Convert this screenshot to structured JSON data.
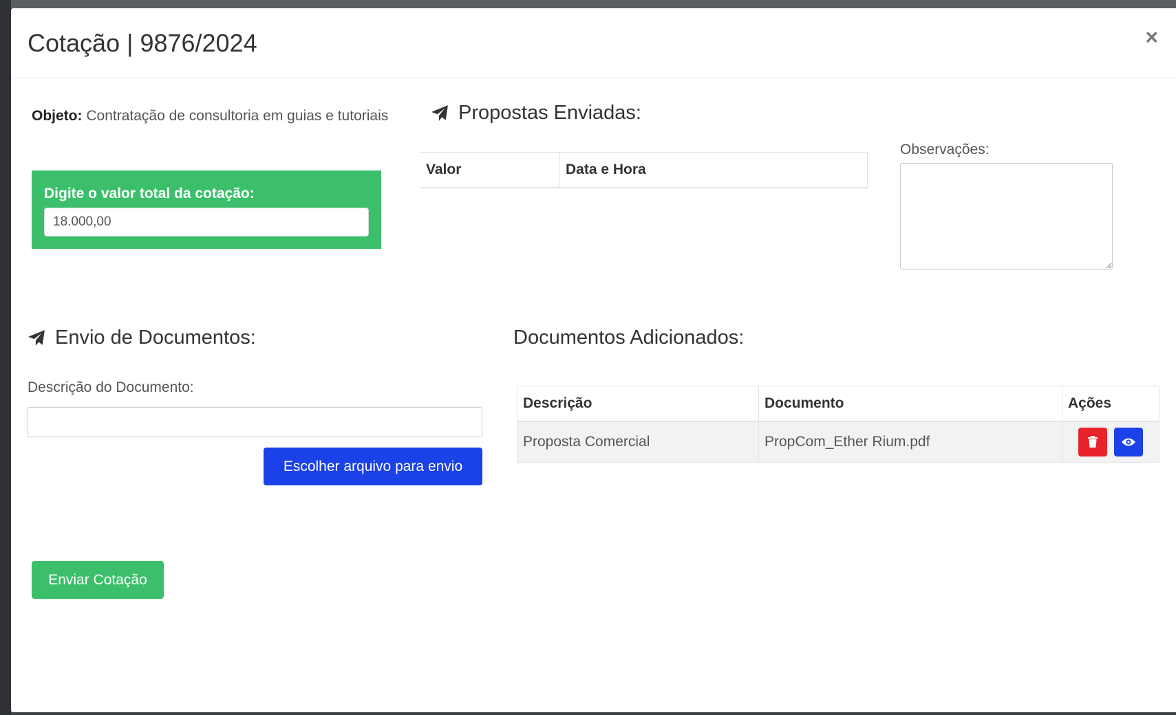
{
  "modal": {
    "title": "Cotação | 9876/2024",
    "close_label": "×"
  },
  "objeto": {
    "label": "Objeto:",
    "text": "Contratação de consultoria em guias e tutoriais"
  },
  "valor": {
    "label": "Digite o valor total da cotação:",
    "value": "18.000,00"
  },
  "propostas": {
    "heading": "Propostas Enviadas:",
    "icon": "paper-plane-icon",
    "columns": [
      "Valor",
      "Data e Hora"
    ],
    "rows": []
  },
  "observacoes": {
    "label": "Observações:",
    "value": ""
  },
  "envio": {
    "heading": "Envio de Documentos:",
    "icon": "paper-plane-icon",
    "descricao_label": "Descrição do Documento:",
    "descricao_value": "",
    "choose_button": "Escolher arquivo para envio"
  },
  "documentos": {
    "heading": "Documentos Adicionados:",
    "columns": [
      "Descrição",
      "Documento",
      "Ações"
    ],
    "rows": [
      {
        "descricao": "Proposta Comercial",
        "documento": "PropCom_Ether Rium.pdf",
        "actions": [
          "trash-icon",
          "eye-icon"
        ]
      }
    ]
  },
  "submit_button": "Enviar Cotação",
  "colors": {
    "success_green": "#3bbf6a",
    "primary_blue": "#1b41e8",
    "danger_red": "#e8232a"
  }
}
